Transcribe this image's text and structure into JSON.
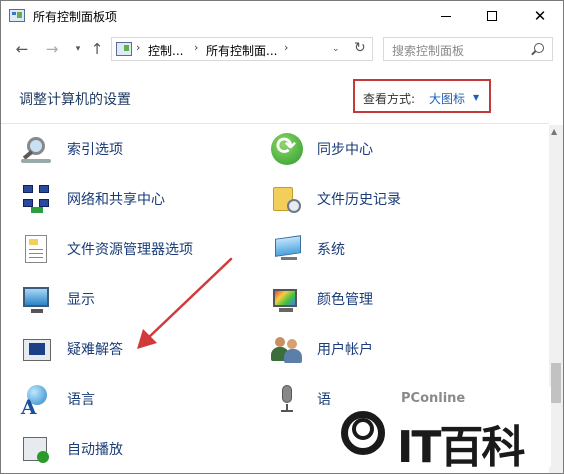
{
  "window": {
    "title": "所有控制面板项",
    "minimize_icon": "minimize-icon",
    "maximize_icon": "maximize-icon",
    "close_glyph": "✕"
  },
  "address": {
    "back_glyph": "←",
    "forward_glyph": "→",
    "recent_glyph": "▾",
    "up_glyph": "↑",
    "crumbs": [
      "控制...",
      "所有控制面..."
    ],
    "separator": "›",
    "dropdown_glyph": "⌄",
    "refresh_glyph": "↻"
  },
  "search": {
    "placeholder": "搜索控制面板"
  },
  "header": {
    "title": "调整计算机的设置",
    "view_by_label": "查看方式:",
    "view_by_value": "大图标",
    "view_by_caret": "▼"
  },
  "items": {
    "left": [
      {
        "label": "索引选项",
        "icon": "indexing-options-icon"
      },
      {
        "label": "网络和共享中心",
        "icon": "network-sharing-icon"
      },
      {
        "label": "文件资源管理器选项",
        "icon": "file-explorer-options-icon"
      },
      {
        "label": "显示",
        "icon": "display-icon"
      },
      {
        "label": "疑难解答",
        "icon": "troubleshooting-icon"
      },
      {
        "label": "语言",
        "icon": "language-icon"
      },
      {
        "label": "自动播放",
        "icon": "autoplay-icon"
      }
    ],
    "right": [
      {
        "label": "同步中心",
        "icon": "sync-center-icon"
      },
      {
        "label": "文件历史记录",
        "icon": "file-history-icon"
      },
      {
        "label": "系统",
        "icon": "system-icon"
      },
      {
        "label": "颜色管理",
        "icon": "color-management-icon"
      },
      {
        "label": "用户帐户",
        "icon": "user-accounts-icon"
      },
      {
        "label": "语音识别",
        "icon": "speech-recognition-icon"
      }
    ]
  },
  "scrollbar": {
    "up_glyph": "▲"
  },
  "watermark": {
    "sub": "PConline",
    "main": "IT百科"
  },
  "colors": {
    "accent_red": "#c6393a",
    "link_blue": "#1a3c78",
    "value_blue": "#1e5fb4"
  }
}
